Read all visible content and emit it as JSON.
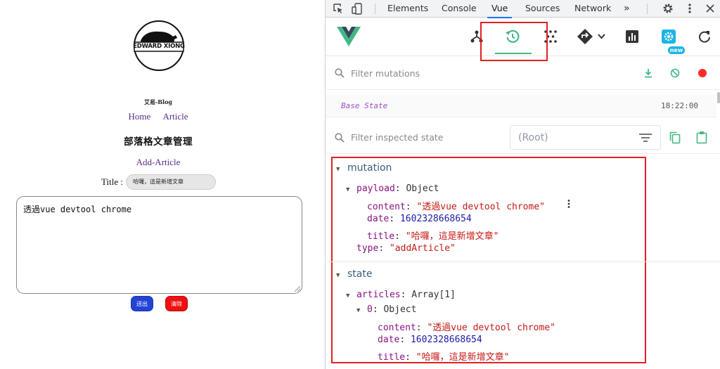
{
  "blog": {
    "logo_text": "EDWARD XIONG",
    "site_name": "艾易-Blog",
    "nav": [
      {
        "label": "Home"
      },
      {
        "label": "Article"
      }
    ],
    "page_title": "部落格文章管理",
    "add_article_link": "Add-Article",
    "title_label": "Title :",
    "title_value": "哈囉，這是新增文章",
    "content_value": "透過vue devtool chrome",
    "submit_label": "送出",
    "clear_label": "清除",
    "submit_color": "#2443d6",
    "clear_color": "#ee1111"
  },
  "devtools": {
    "tabs": [
      {
        "label": "Elements"
      },
      {
        "label": "Console"
      },
      {
        "label": "Vue",
        "active": true
      },
      {
        "label": "Sources"
      },
      {
        "label": "Network"
      }
    ],
    "more_tabs": "»",
    "vue_toolbar": {
      "icons": [
        "components-icon",
        "history-icon",
        "vuex-events-icon",
        "routing-icon",
        "performance-icon",
        "settings-icon",
        "refresh-icon"
      ],
      "new_badge": "new",
      "accent_color": "#42b983"
    },
    "mutations": {
      "filter_placeholder": "Filter mutations",
      "base_state_label": "Base State",
      "base_state_time": "18:22:00"
    },
    "inspector": {
      "filter_placeholder": "Filter inspected state",
      "root_selector": "(Root)"
    },
    "mutation_section": {
      "title": "mutation",
      "payload_key": "payload",
      "payload_type": "Object",
      "content_key": "content",
      "content_value": "\"透過vue devtool chrome\"",
      "date_key": "date",
      "date_value": "1602328668654",
      "title_key": "title",
      "title_value": "\"哈囉，這是新增文章\"",
      "type_key": "type",
      "type_value": "\"addArticle\""
    },
    "state_section": {
      "title": "state",
      "articles_key": "articles",
      "articles_type": "Array[1]",
      "item_key": "0",
      "item_type": "Object",
      "content_key": "content",
      "content_value": "\"透過vue devtool chrome\"",
      "date_key": "date",
      "date_value": "1602328668654",
      "title_key": "title",
      "title_value": "\"哈囉，這是新增文章\""
    }
  }
}
